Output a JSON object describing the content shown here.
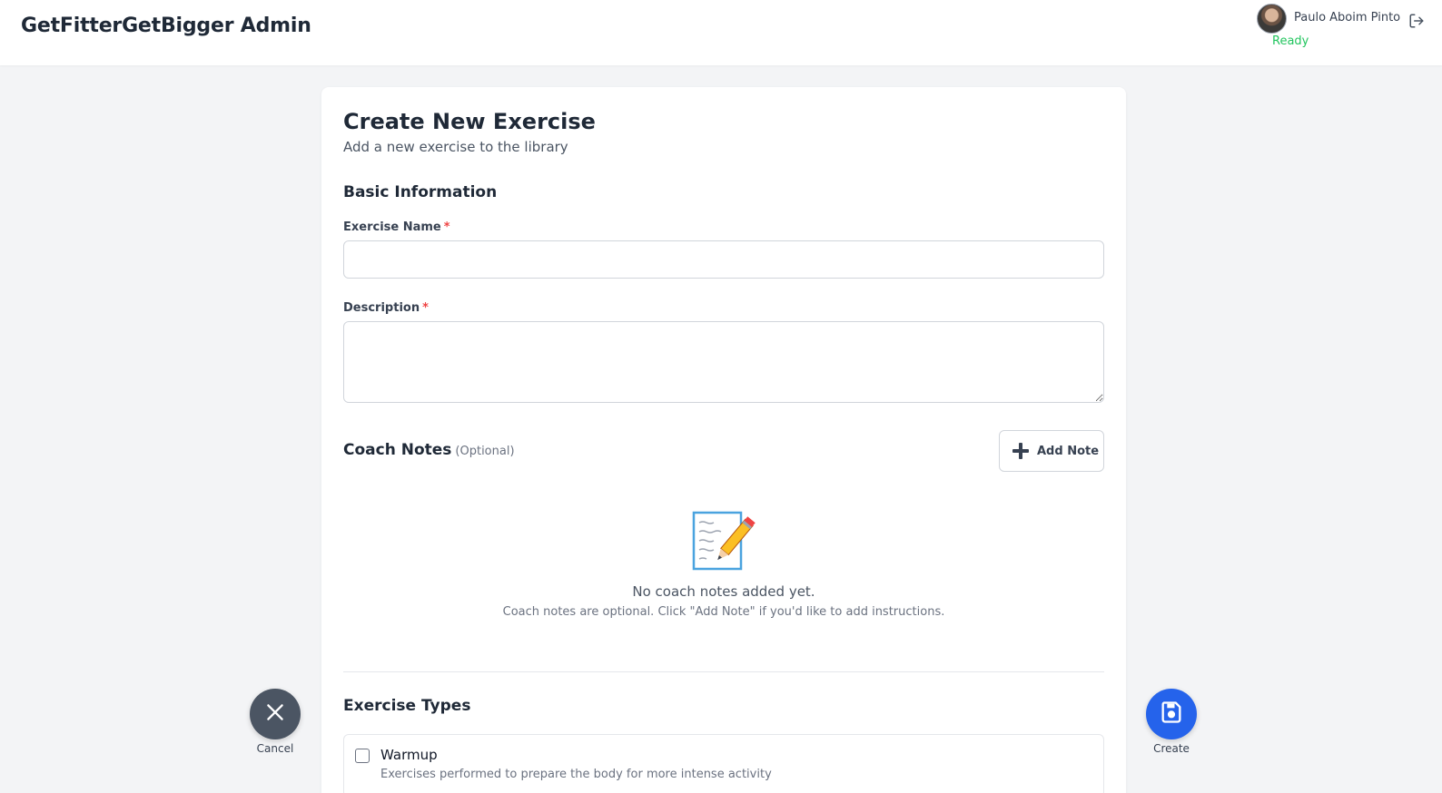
{
  "header": {
    "app_title": "GetFitterGetBigger Admin",
    "user_name": "Paulo Aboim Pinto",
    "status": "Ready",
    "status_color": "#22c55e",
    "avatar_icon": "user-avatar",
    "logout_icon": "logout-icon"
  },
  "form": {
    "title": "Create New Exercise",
    "subtitle": "Add a new exercise to the library",
    "basic_info": {
      "heading": "Basic Information",
      "name_label": "Exercise Name",
      "name_value": "",
      "required_marker": "*",
      "description_label": "Description",
      "description_value": ""
    },
    "coach_notes": {
      "heading": "Coach Notes",
      "optional_text": "(Optional)",
      "add_button_label": "Add Note",
      "empty_icon": "memo-icon",
      "empty_title": "No coach notes added yet.",
      "empty_hint": "Coach notes are optional. Click \"Add Note\" if you'd like to add instructions."
    },
    "exercise_types": {
      "heading": "Exercise Types",
      "items": [
        {
          "label": "Warmup",
          "description": "Exercises performed to prepare the body for more intense activity",
          "checked": false
        }
      ]
    }
  },
  "actions": {
    "cancel_label": "Cancel",
    "create_label": "Create",
    "cancel_color": "#4b5563",
    "create_color": "#2563eb"
  }
}
